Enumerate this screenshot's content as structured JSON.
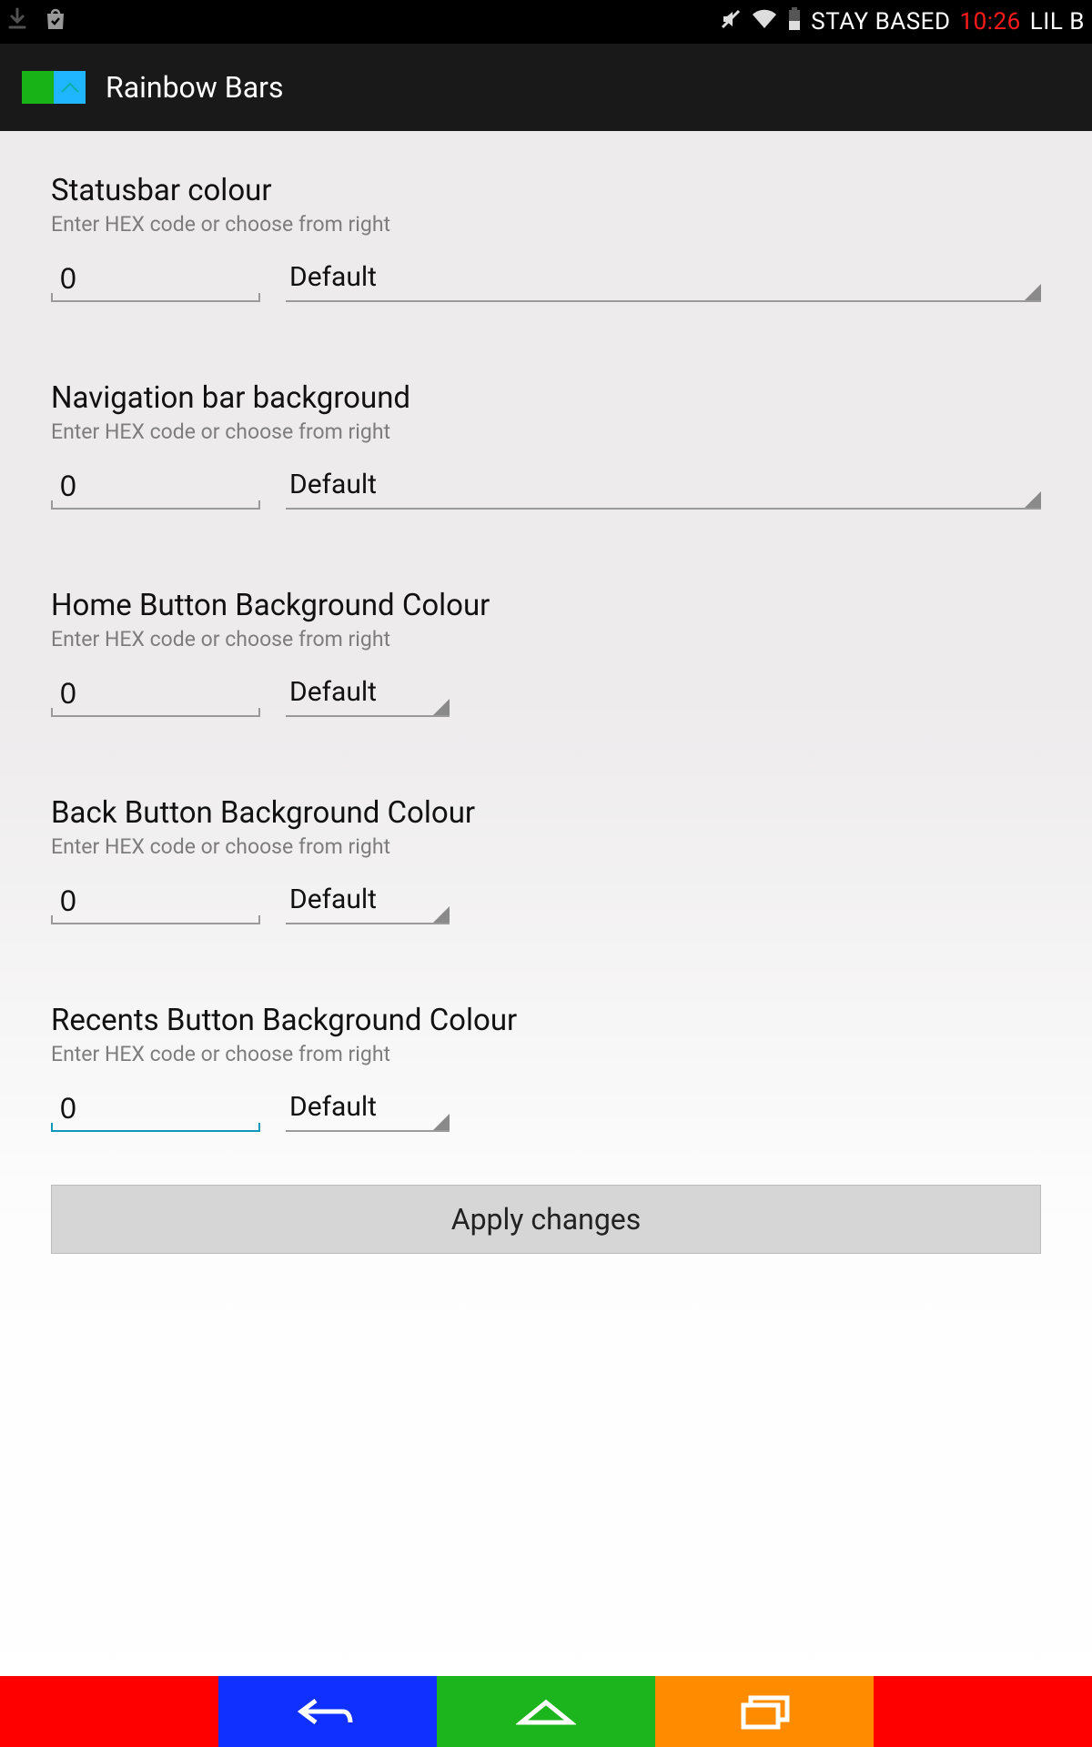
{
  "statusbar": {
    "text_before": "STAY BASED",
    "time": "10:26",
    "text_after": "LIL B"
  },
  "actionbar": {
    "title": "Rainbow Bars"
  },
  "common": {
    "subtitle": "Enter HEX code or choose from right"
  },
  "sections": {
    "status": {
      "title": "Statusbar colour",
      "hex": "0",
      "choice": "Default"
    },
    "nav": {
      "title": "Navigation bar background",
      "hex": "0",
      "choice": "Default"
    },
    "home": {
      "title": "Home Button Background Colour",
      "hex": "0",
      "choice": "Default"
    },
    "back": {
      "title": "Back Button Background Colour",
      "hex": "0",
      "choice": "Default"
    },
    "recents": {
      "title": "Recents Button Background Colour",
      "hex": "0",
      "choice": "Default"
    }
  },
  "apply": {
    "label": "Apply changes"
  },
  "navbar": {
    "colors": [
      "#ff0000",
      "#1030ff",
      "#1db51d",
      "#ff8c00",
      "#ff0000"
    ]
  }
}
